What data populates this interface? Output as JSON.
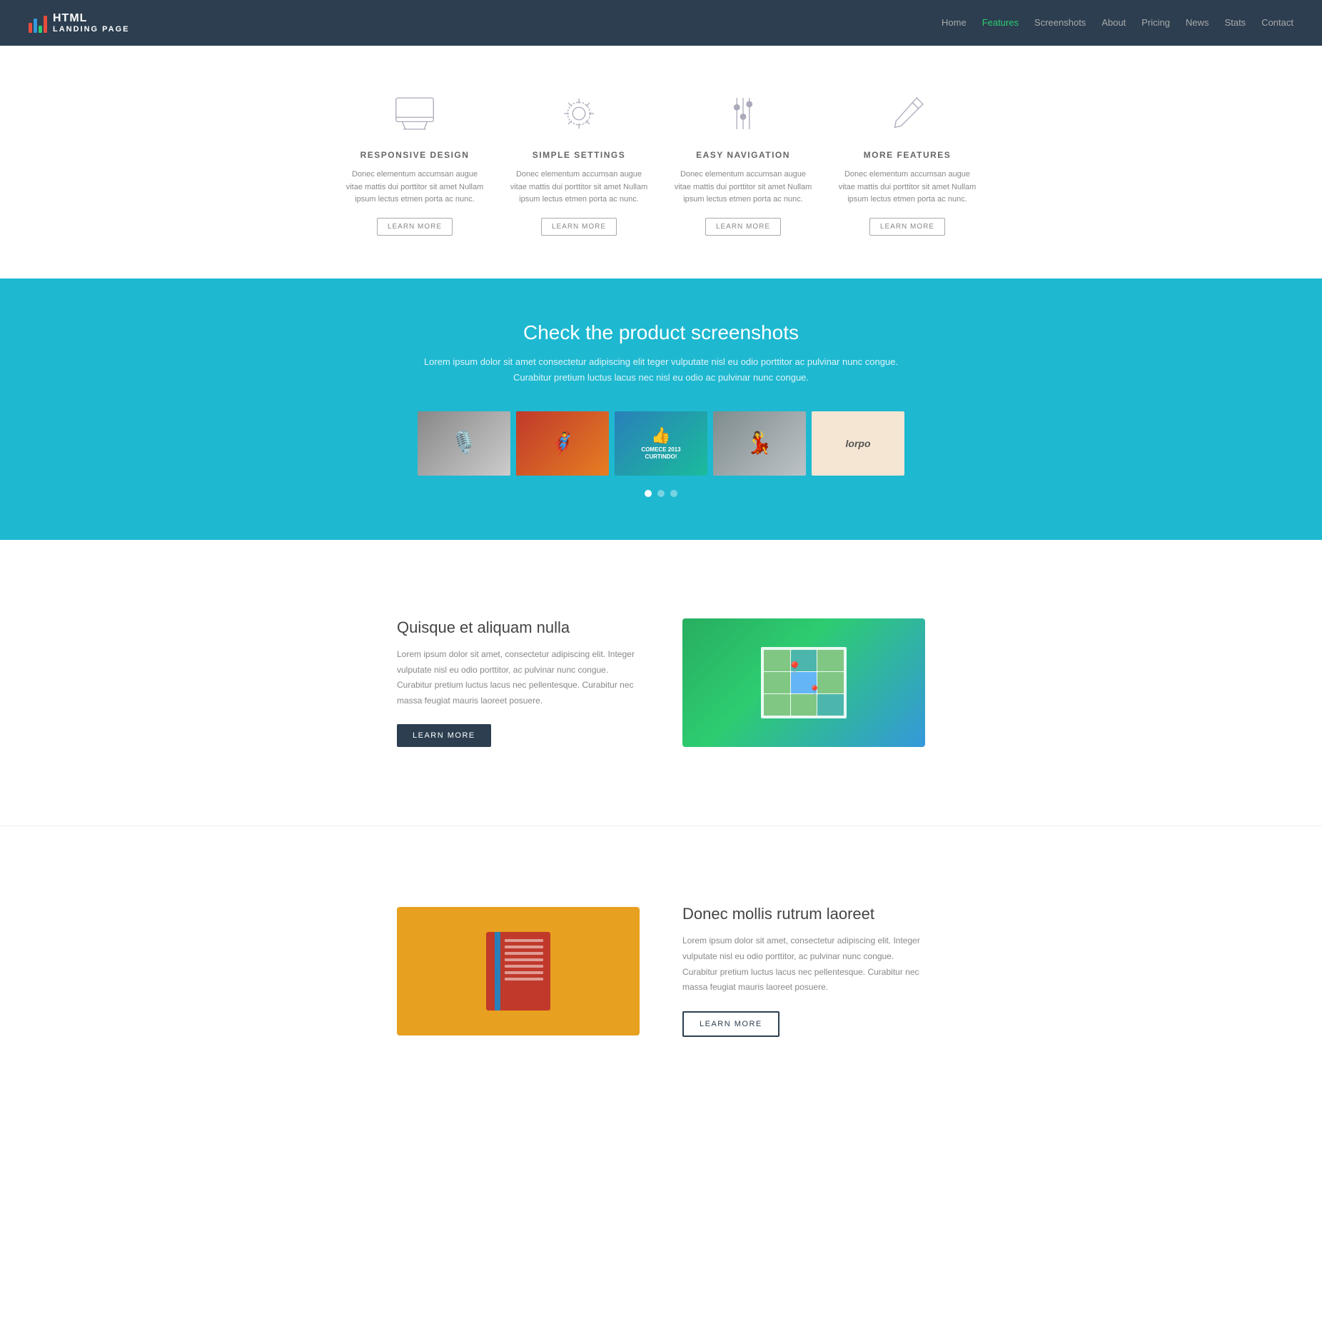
{
  "nav": {
    "brand_html": "HTML",
    "brand_sub": "LANDING PAGE",
    "links": [
      {
        "label": "Home",
        "href": "#",
        "active": false
      },
      {
        "label": "Features",
        "href": "#",
        "active": true
      },
      {
        "label": "Screenshots",
        "href": "#",
        "active": false
      },
      {
        "label": "About",
        "href": "#",
        "active": false
      },
      {
        "label": "Pricing",
        "href": "#",
        "active": false
      },
      {
        "label": "News",
        "href": "#",
        "active": false
      },
      {
        "label": "Stats",
        "href": "#",
        "active": false
      },
      {
        "label": "Contact",
        "href": "#",
        "active": false
      }
    ]
  },
  "features": {
    "cards": [
      {
        "title": "RESPONSIVE DESIGN",
        "desc": "Donec elementum accumsan augue vitae mattis dui porttitor sit amet Nullam ipsum lectus etmen porta ac nunc.",
        "btn": "LEARN MORE"
      },
      {
        "title": "SIMPLE SETTINGS",
        "desc": "Donec elementum accumsan augue vitae mattis dui porttitor sit amet Nullam ipsum lectus etmen porta ac nunc.",
        "btn": "LEARN MORE"
      },
      {
        "title": "EASY NAVIGATION",
        "desc": "Donec elementum accumsan augue vitae mattis dui porttitor sit amet Nullam ipsum lectus etmen porta ac nunc.",
        "btn": "LEARN MORE"
      },
      {
        "title": "MORE FEATURES",
        "desc": "Donec elementum accumsan augue vitae mattis dui porttitor sit amet Nullam ipsum lectus etmen porta ac nunc.",
        "btn": "LEARN MORE"
      }
    ]
  },
  "screenshots": {
    "title": "Check the product screenshots",
    "desc_line1": "Lorem ipsum dolor sit amet consectetur adipiscing elit teger vulputate nisl eu odio porttitor ac pulvinar nunc congue.",
    "desc_line2": "Curabitur pretium luctus lacus nec nisl eu odio ac pulvinar nunc congue.",
    "thumbs": [
      {
        "label": "Microphone",
        "content": "🎤"
      },
      {
        "label": "Person",
        "content": "🦸"
      },
      {
        "label": "Like",
        "content": "👍\nCOMECE 2013\nCURTINDO!"
      },
      {
        "label": "Girl sky",
        "content": "💃"
      },
      {
        "label": "Card",
        "content": "lorpo"
      }
    ]
  },
  "section1": {
    "title": "Quisque et aliquam nulla",
    "desc": "Lorem ipsum dolor sit amet, consectetur adipiscing elit. Integer vulputate nisl eu odio porttitor, ac pulvinar nunc congue. Curabitur pretium luctus lacus nec pellentesque. Curabitur nec massa feugiat mauris laoreet posuere.",
    "btn": "LEARN MORE"
  },
  "section2": {
    "title": "Donec mollis rutrum laoreet",
    "desc": "Lorem ipsum dolor sit amet, consectetur adipiscing elit. Integer vulputate nisl eu odio porttitor, ac pulvinar nunc congue. Curabitur pretium luctus lacus nec pellentesque. Curabitur nec massa feugiat mauris laoreet posuere.",
    "btn": "LEARN MORE"
  }
}
